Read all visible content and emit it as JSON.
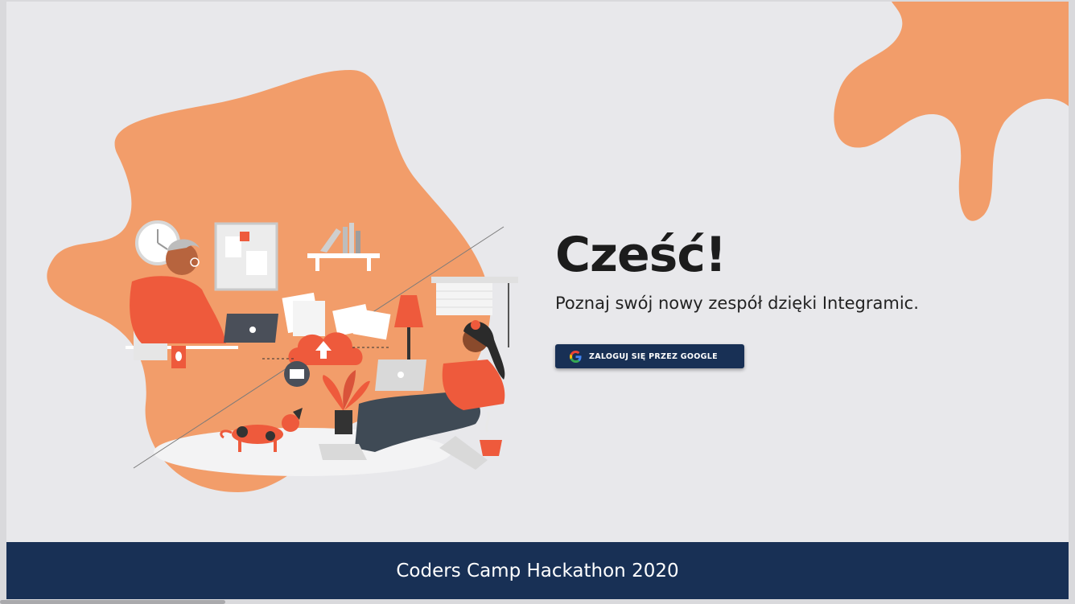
{
  "hero": {
    "title": "Cześć!",
    "subtitle": "Poznaj swój nowy zespół dzięki Integramic."
  },
  "login_button": {
    "label": "ZALOGUJ SIĘ PRZEZ GOOGLE",
    "icon": "google-icon"
  },
  "footer": {
    "text": "Coders Camp Hackathon 2020"
  },
  "colors": {
    "accent_orange": "#f29d6a",
    "navy": "#183055",
    "background": "#e8e8eb",
    "illustration_red": "#ee5a3c"
  }
}
